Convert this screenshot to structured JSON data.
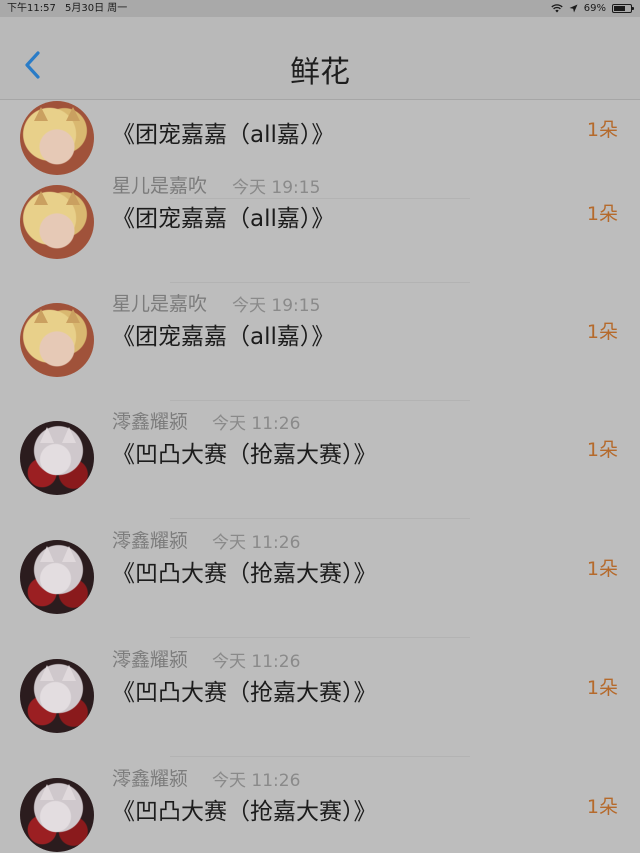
{
  "status_bar": {
    "time": "下午11:57",
    "date": "5月30日 周一",
    "wifi_icon": "wifi-icon",
    "location_icon": "location-arrow-icon",
    "battery_percent": "69%",
    "battery_level": 0.69
  },
  "nav": {
    "back_icon": "chevron-left-icon",
    "title": "鲜花",
    "accent_color": "#2a7cc7"
  },
  "items": [
    {
      "user": "",
      "time": "",
      "title": "《团宠嘉嘉（all嘉）》",
      "count": "1朵",
      "avatar": "blonde"
    },
    {
      "user": "星儿是嘉吹",
      "time": "今天 19:15",
      "title": "《团宠嘉嘉（all嘉）》",
      "count": "1朵",
      "avatar": "blonde"
    },
    {
      "user": "星儿是嘉吹",
      "time": "今天 19:15",
      "title": "《团宠嘉嘉（all嘉）》",
      "count": "1朵",
      "avatar": "blonde"
    },
    {
      "user": "澪鑫耀颍",
      "time": "今天 11:26",
      "title": "《凹凸大赛（抢嘉大赛）》",
      "count": "1朵",
      "avatar": "fox"
    },
    {
      "user": "澪鑫耀颍",
      "time": "今天 11:26",
      "title": "《凹凸大赛（抢嘉大赛）》",
      "count": "1朵",
      "avatar": "fox"
    },
    {
      "user": "澪鑫耀颍",
      "time": "今天 11:26",
      "title": "《凹凸大赛（抢嘉大赛）》",
      "count": "1朵",
      "avatar": "fox"
    },
    {
      "user": "澪鑫耀颍",
      "time": "今天 11:26",
      "title": "《凹凸大赛（抢嘉大赛）》",
      "count": "1朵",
      "avatar": "fox"
    }
  ],
  "colors": {
    "count_color": "#b56a2c",
    "dim_overlay": "#bdbdbd"
  }
}
